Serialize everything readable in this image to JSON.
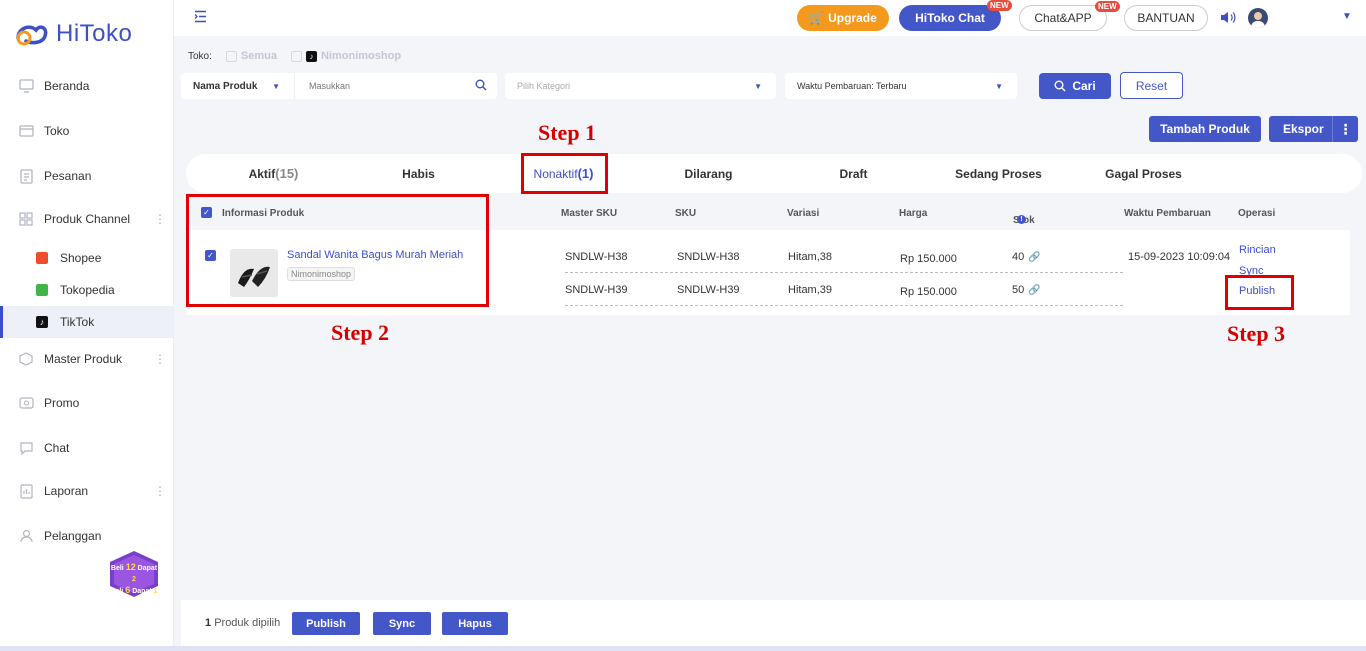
{
  "brand": {
    "name": "HiToko",
    "accent": "#3d4fc8"
  },
  "sidebar": {
    "items": [
      {
        "label": "Beranda",
        "icon": "monitor-icon"
      },
      {
        "label": "Toko",
        "icon": "store-icon"
      },
      {
        "label": "Pesanan",
        "icon": "order-icon"
      },
      {
        "label": "Produk Channel",
        "icon": "grid-icon"
      },
      {
        "label": "Master Produk",
        "icon": "box-icon"
      },
      {
        "label": "Promo",
        "icon": "promo-icon"
      },
      {
        "label": "Chat",
        "icon": "chat-icon"
      },
      {
        "label": "Laporan",
        "icon": "report-icon"
      },
      {
        "label": "Pelanggan",
        "icon": "customer-icon"
      }
    ],
    "channels": [
      {
        "label": "Shopee",
        "icon": "shopee-icon"
      },
      {
        "label": "Tokopedia",
        "icon": "tokopedia-icon"
      },
      {
        "label": "TikTok",
        "icon": "tiktok-icon",
        "active": true
      }
    ],
    "promo_badge": {
      "line1_pre": "Beli",
      "line1_num": "12",
      "line1_mid": "Dapat",
      "line1_end": "2",
      "line2_pre": "Beli",
      "line2_num": "6",
      "line2_mid": "Dapat",
      "line2_end": "1"
    }
  },
  "header": {
    "upgrade": "Upgrade",
    "hitoko_chat": "HiToko Chat",
    "chat_app": "Chat&APP",
    "bantuan": "BANTUAN",
    "new_badge": "NEW"
  },
  "filters": {
    "toko_label": "Toko:",
    "toko_all": "Semua",
    "toko_shop": "Nimonimoshop",
    "search_field": "Nama Produk",
    "search_placeholder": "Masukkan",
    "category_placeholder": "Pilih Kategori",
    "sort_value": "Waktu Pembaruan: Terbaru",
    "search_button": "Cari",
    "reset_button": "Reset"
  },
  "actions": {
    "add_product": "Tambah Produk",
    "export": "Ekspor"
  },
  "tabs": [
    {
      "label": "Aktif",
      "count": "(15)"
    },
    {
      "label": "Habis",
      "count": ""
    },
    {
      "label": "Nonaktif",
      "count": "(1)",
      "active": true
    },
    {
      "label": "Dilarang",
      "count": ""
    },
    {
      "label": "Draft",
      "count": ""
    },
    {
      "label": "Sedang Proses",
      "count": ""
    },
    {
      "label": "Gagal Proses",
      "count": ""
    }
  ],
  "table": {
    "columns": [
      "Informasi Produk",
      "Master SKU",
      "SKU",
      "Variasi",
      "Harga",
      "Stok",
      "Waktu Pembaruan",
      "Operasi"
    ],
    "product": {
      "name": "Sandal Wanita Bagus Murah Meriah",
      "shop": "Nimonimoshop",
      "updated": "15-09-2023 10:09:04",
      "operations": [
        "Rincian",
        "Sync",
        "Publish"
      ],
      "variants": [
        {
          "master_sku": "SNDLW-H38",
          "sku": "SNDLW-H38",
          "variation": "Hitam,38",
          "price": "Rp 150.000",
          "stock": "40"
        },
        {
          "master_sku": "SNDLW-H39",
          "sku": "SNDLW-H39",
          "variation": "Hitam,39",
          "price": "Rp 150.000",
          "stock": "50"
        }
      ]
    }
  },
  "annotations": {
    "step1": "Step 1",
    "step2": "Step 2",
    "step3": "Step 3",
    "box_color": "#e00000"
  },
  "bottom": {
    "selected_count": "1",
    "selected_label": "Produk dipilih",
    "publish": "Publish",
    "sync": "Sync",
    "delete": "Hapus"
  }
}
